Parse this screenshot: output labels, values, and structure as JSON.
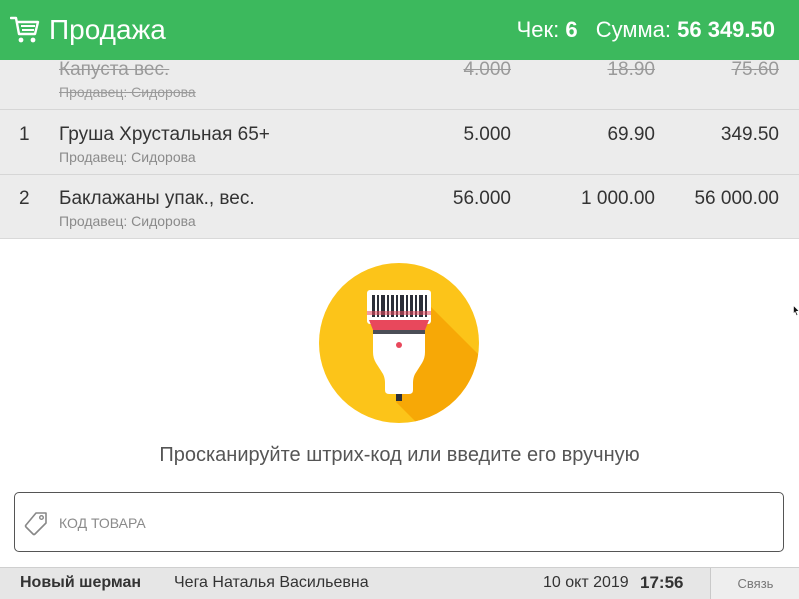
{
  "header": {
    "title": "Продажа",
    "check_label": "Чек:",
    "check_number": "6",
    "sum_label": "Сумма:",
    "sum_value": "56 349.50",
    "icon": "cart-icon",
    "background_color": "#3cb95d"
  },
  "items": [
    {
      "num": "",
      "name": "Капуста вес.",
      "seller": "Продавец: Сидорова",
      "qty": "4.000",
      "price": "18.90",
      "total": "75.60",
      "cancelled": true
    },
    {
      "num": "1",
      "name": "Груша Хрустальная 65+",
      "seller": "Продавец: Сидорова",
      "qty": "5.000",
      "price": "69.90",
      "total": "349.50",
      "cancelled": false
    },
    {
      "num": "2",
      "name": "Баклажаны упак., вес.",
      "seller": "Продавец: Сидорова",
      "qty": "56.000",
      "price": "1 000.00",
      "total": "56 000.00",
      "cancelled": false
    }
  ],
  "scanner": {
    "icon": "barcode-scanner-icon",
    "hint": "Просканируйте штрих-код или введите его вручную"
  },
  "code_input": {
    "placeholder": "КОД ТОВАРА",
    "value": "",
    "icon": "tag-icon"
  },
  "footer": {
    "store": "Новый шерман",
    "cashier": "Чега Наталья Васильевна",
    "date": "10 окт 2019",
    "time": "17:56",
    "connection": "Связь"
  }
}
